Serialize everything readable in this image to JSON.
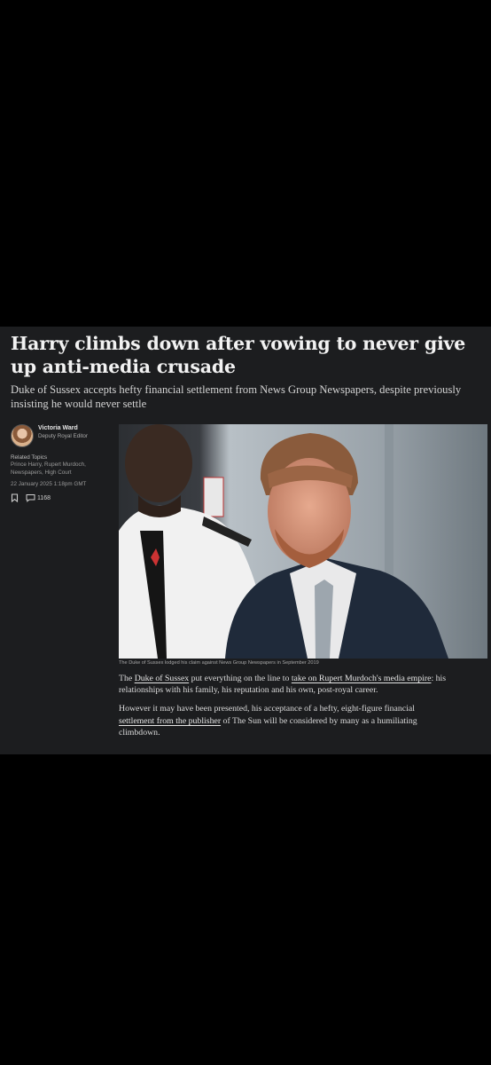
{
  "article": {
    "headline": "Harry climbs down after vowing to never give up anti-media crusade",
    "standfirst": "Duke of Sussex accepts hefty financial settlement from News Group Newspapers, despite previously insisting he would never settle",
    "author": {
      "name": "Victoria Ward",
      "role": "Deputy Royal Editor"
    },
    "related_topics_title": "Related Topics",
    "related_topics": "Prince Harry, Rupert Murdoch, Newspapers, High Court",
    "date": "22 January 2025 1:18pm GMT",
    "comment_count": "1168",
    "photo_caption": "The Duke of Sussex lodged his claim against News Group Newspapers in September 2019",
    "paragraph1": {
      "t1": "The ",
      "link1": "Duke of Sussex",
      "t2": " put everything on the line to ",
      "link2": "take on Rupert Murdoch's media empire",
      "t3": ": his relationships with his family, his reputation and his own, post-royal career."
    },
    "paragraph2": {
      "t1": "However it may have been presented, his acceptance of a hefty, eight-figure financial ",
      "link1": "settlement from the publisher",
      "t2": " of The Sun will be considered by many as a humiliating climbdown."
    }
  },
  "colors": {
    "page_bg": "#000000",
    "article_bg": "#1c1d1f",
    "text": "#f2f2f2"
  }
}
